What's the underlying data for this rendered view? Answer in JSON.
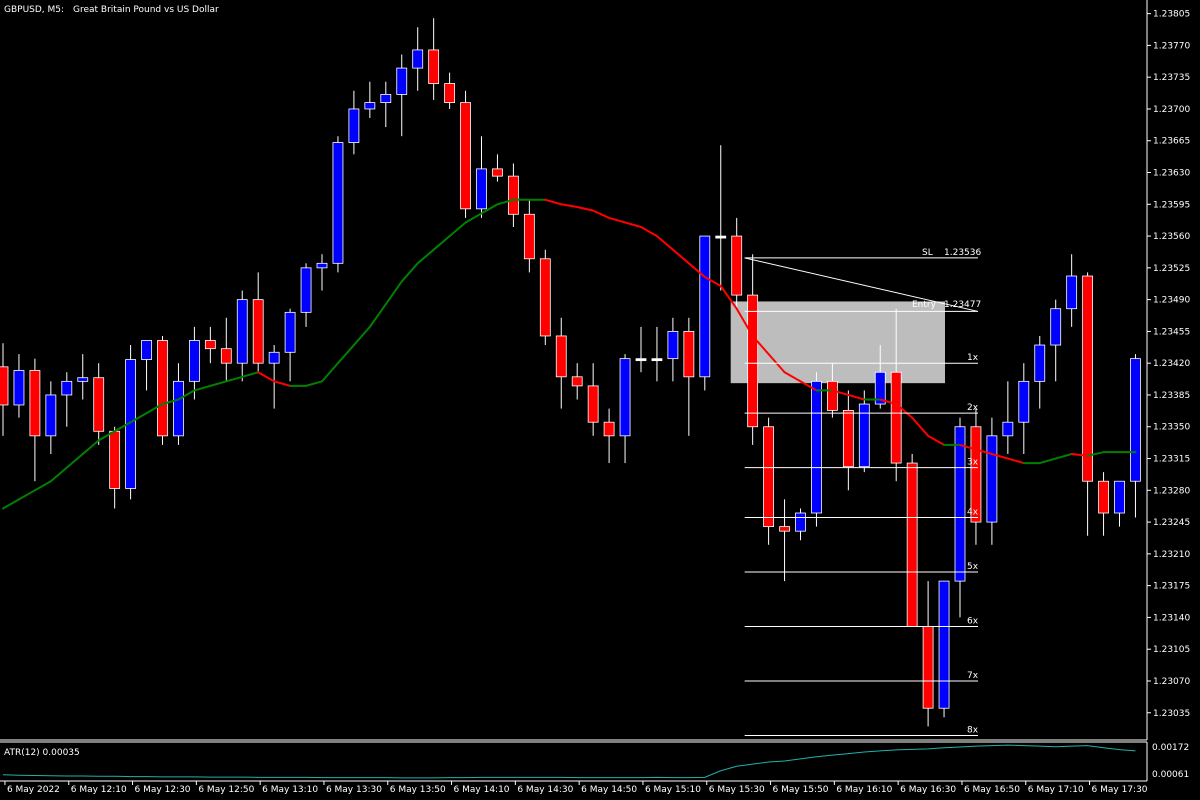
{
  "header": {
    "symbol_timeframe": "GBPUSD, M5:",
    "description": "Great Britain Pound vs US Dollar"
  },
  "indicator": {
    "label": "ATR(12) 0.00035",
    "scale_labels": [
      "0.00172",
      "0.00061"
    ],
    "range": [
      0.0004,
      0.0018
    ],
    "values": [
      0.0006,
      0.00058,
      0.00057,
      0.00056,
      0.00055,
      0.00055,
      0.00054,
      0.00054,
      0.00053,
      0.00053,
      0.00052,
      0.00052,
      0.00052,
      0.00051,
      0.00051,
      0.00051,
      0.0005,
      0.0005,
      0.0005,
      0.0005,
      0.00049,
      0.00049,
      0.00049,
      0.00049,
      0.00049,
      0.00048,
      0.00048,
      0.00048,
      0.00049,
      0.00049,
      0.0005,
      0.0005,
      0.0005,
      0.0005,
      0.0005,
      0.0005,
      0.00049,
      0.00049,
      0.00049,
      0.00049,
      0.00049,
      0.0005,
      0.00049,
      0.00049,
      0.0005,
      0.00075,
      0.00092,
      0.001,
      0.00108,
      0.00112,
      0.0012,
      0.00128,
      0.00134,
      0.0014,
      0.00146,
      0.0015,
      0.00154,
      0.00156,
      0.00158,
      0.00162,
      0.00165,
      0.00168,
      0.0017,
      0.00172,
      0.0017,
      0.00168,
      0.00166,
      0.00168,
      0.0017,
      0.00162,
      0.00155,
      0.0015
    ]
  },
  "colors": {
    "background": "#000000",
    "bull": "#0000ff",
    "bear": "#ff0000",
    "wick": "#ffffff",
    "ma_up": "#008000",
    "ma_down": "#ff0000",
    "atr_line": "#20b2aa",
    "box": "#bdbdbd"
  },
  "trade_overlay": {
    "sl_label": "SL",
    "sl_price": "1.23536",
    "entry_label": "Entry",
    "entry_price": "1.23477",
    "levels": [
      {
        "label": "1x",
        "price": 1.2342
      },
      {
        "label": "2x",
        "price": 1.23365
      },
      {
        "label": "3x",
        "price": 1.23305
      },
      {
        "label": "4x",
        "price": 1.2325
      },
      {
        "label": "5x",
        "price": 1.2319
      },
      {
        "label": "6x",
        "price": 1.2313
      },
      {
        "label": "7x",
        "price": 1.2307
      },
      {
        "label": "8x",
        "price": 1.2301
      }
    ],
    "box_top": 1.23488,
    "box_bottom": 1.23398
  },
  "chart_data": {
    "type": "candlestick",
    "title": "GBPUSD, M5: Great Britain Pound vs US Dollar",
    "ylim": [
      1.23005,
      1.2382
    ],
    "y_ticks": [
      "1.23805",
      "1.23770",
      "1.23735",
      "1.23700",
      "1.23665",
      "1.23630",
      "1.23595",
      "1.23560",
      "1.23525",
      "1.23490",
      "1.23455",
      "1.23420",
      "1.23385",
      "1.23350",
      "1.23315",
      "1.23280",
      "1.23245",
      "1.23210",
      "1.23175",
      "1.23140",
      "1.23105",
      "1.23070",
      "1.23035"
    ],
    "x_ticks": [
      {
        "index": 1,
        "label": "6 May 2022"
      },
      {
        "index": 5,
        "label": "6 May 12:10"
      },
      {
        "index": 9,
        "label": "6 May 12:30"
      },
      {
        "index": 13,
        "label": "6 May 12:50"
      },
      {
        "index": 17,
        "label": "6 May 13:10"
      },
      {
        "index": 21,
        "label": "6 May 13:30"
      },
      {
        "index": 25,
        "label": "6 May 13:50"
      },
      {
        "index": 29,
        "label": "6 May 14:10"
      },
      {
        "index": 33,
        "label": "6 May 14:30"
      },
      {
        "index": 37,
        "label": "6 May 14:50"
      },
      {
        "index": 41,
        "label": "6 May 15:10"
      },
      {
        "index": 45,
        "label": "6 May 15:30"
      },
      {
        "index": 49,
        "label": "6 May 15:50"
      },
      {
        "index": 53,
        "label": "6 May 16:10"
      },
      {
        "index": 57,
        "label": "6 May 16:30"
      },
      {
        "index": 61,
        "label": "6 May 16:50"
      },
      {
        "index": 65,
        "label": "6 May 17:10"
      },
      {
        "index": 69,
        "label": "6 May 17:30"
      }
    ],
    "ohlc": [
      [
        1.23416,
        1.23442,
        1.2334,
        1.23374
      ],
      [
        1.23374,
        1.2343,
        1.2336,
        1.23412
      ],
      [
        1.23412,
        1.23425,
        1.2329,
        1.2334
      ],
      [
        1.2334,
        1.234,
        1.2332,
        1.23385
      ],
      [
        1.23385,
        1.2341,
        1.2335,
        1.234
      ],
      [
        1.234,
        1.2343,
        1.2338,
        1.23404
      ],
      [
        1.23404,
        1.2342,
        1.2333,
        1.23345
      ],
      [
        1.23345,
        1.2335,
        1.2326,
        1.23282
      ],
      [
        1.23282,
        1.2344,
        1.2327,
        1.23424
      ],
      [
        1.23424,
        1.2344,
        1.2339,
        1.23445
      ],
      [
        1.23445,
        1.2345,
        1.2333,
        1.2334
      ],
      [
        1.2334,
        1.2342,
        1.2333,
        1.234
      ],
      [
        1.234,
        1.2346,
        1.2338,
        1.23445
      ],
      [
        1.23445,
        1.2346,
        1.2342,
        1.23436
      ],
      [
        1.23436,
        1.2347,
        1.234,
        1.2342
      ],
      [
        1.2342,
        1.235,
        1.234,
        1.2349
      ],
      [
        1.2349,
        1.2352,
        1.2341,
        1.2342
      ],
      [
        1.2342,
        1.2344,
        1.2337,
        1.23432
      ],
      [
        1.23432,
        1.2348,
        1.234,
        1.23476
      ],
      [
        1.23476,
        1.2353,
        1.2346,
        1.23525
      ],
      [
        1.23525,
        1.2354,
        1.235,
        1.2353
      ],
      [
        1.2353,
        1.2367,
        1.2352,
        1.23663
      ],
      [
        1.23663,
        1.2372,
        1.2365,
        1.237
      ],
      [
        1.237,
        1.2373,
        1.2369,
        1.23707
      ],
      [
        1.23707,
        1.2373,
        1.2368,
        1.23716
      ],
      [
        1.23716,
        1.2376,
        1.2367,
        1.23745
      ],
      [
        1.23745,
        1.2379,
        1.2372,
        1.23765
      ],
      [
        1.23765,
        1.238,
        1.2371,
        1.23728
      ],
      [
        1.23728,
        1.2374,
        1.237,
        1.23707
      ],
      [
        1.23707,
        1.2372,
        1.2358,
        1.2359
      ],
      [
        1.2359,
        1.2367,
        1.2358,
        1.23634
      ],
      [
        1.23634,
        1.2365,
        1.2362,
        1.23626
      ],
      [
        1.23626,
        1.2364,
        1.2357,
        1.23584
      ],
      [
        1.23584,
        1.236,
        1.2352,
        1.23535
      ],
      [
        1.23535,
        1.23545,
        1.2344,
        1.2345
      ],
      [
        1.2345,
        1.2347,
        1.2337,
        1.23405
      ],
      [
        1.23405,
        1.2342,
        1.2338,
        1.23395
      ],
      [
        1.23395,
        1.2342,
        1.2334,
        1.23355
      ],
      [
        1.23355,
        1.2337,
        1.2331,
        1.2334
      ],
      [
        1.2334,
        1.2343,
        1.2331,
        1.23425
      ],
      [
        1.23425,
        1.2346,
        1.2341,
        1.23425
      ],
      [
        1.23425,
        1.2346,
        1.234,
        1.23425
      ],
      [
        1.23425,
        1.2347,
        1.234,
        1.23455
      ],
      [
        1.23455,
        1.2347,
        1.2334,
        1.23405
      ],
      [
        1.23405,
        1.2353,
        1.2339,
        1.2356
      ],
      [
        1.2356,
        1.2366,
        1.235,
        1.2356
      ],
      [
        1.2356,
        1.2358,
        1.2348,
        1.23495
      ],
      [
        1.23495,
        1.2354,
        1.2333,
        1.2335
      ],
      [
        1.2335,
        1.2336,
        1.2322,
        1.2324
      ],
      [
        1.2324,
        1.2327,
        1.2318,
        1.23235
      ],
      [
        1.23235,
        1.2326,
        1.23225,
        1.23255
      ],
      [
        1.23255,
        1.2341,
        1.2324,
        1.234
      ],
      [
        1.234,
        1.2342,
        1.2336,
        1.23368
      ],
      [
        1.23368,
        1.2339,
        1.2328,
        1.23306
      ],
      [
        1.23306,
        1.2339,
        1.233,
        1.23375
      ],
      [
        1.23375,
        1.2344,
        1.2337,
        1.2341
      ],
      [
        1.2341,
        1.2348,
        1.2329,
        1.2331
      ],
      [
        1.2331,
        1.2332,
        1.2313,
        1.2313
      ],
      [
        1.2313,
        1.2318,
        1.2302,
        1.2304
      ],
      [
        1.2304,
        1.2318,
        1.2303,
        1.2318
      ],
      [
        1.2318,
        1.2336,
        1.2314,
        1.2335
      ],
      [
        1.2335,
        1.2337,
        1.2322,
        1.23245
      ],
      [
        1.23245,
        1.2336,
        1.2322,
        1.2334
      ],
      [
        1.2334,
        1.234,
        1.2332,
        1.23355
      ],
      [
        1.23355,
        1.2342,
        1.2332,
        1.234
      ],
      [
        1.234,
        1.2345,
        1.2337,
        1.2344
      ],
      [
        1.2344,
        1.2349,
        1.234,
        1.2348
      ],
      [
        1.2348,
        1.2354,
        1.2346,
        1.23516
      ],
      [
        1.23516,
        1.2352,
        1.2323,
        1.2329
      ],
      [
        1.2329,
        1.233,
        1.2323,
        1.23255
      ],
      [
        1.23255,
        1.2329,
        1.2324,
        1.2329
      ],
      [
        1.2329,
        1.2343,
        1.2325,
        1.23425
      ]
    ],
    "moving_average": [
      1.2326,
      1.2327,
      1.2328,
      1.2329,
      1.23305,
      1.2332,
      1.23335,
      1.23345,
      1.23355,
      1.23365,
      1.23375,
      1.2338,
      1.2339,
      1.23395,
      1.234,
      1.23405,
      1.2341,
      1.234,
      1.23395,
      1.23395,
      1.234,
      1.2342,
      1.2344,
      1.2346,
      1.23485,
      1.2351,
      1.2353,
      1.23545,
      1.2356,
      1.23575,
      1.23585,
      1.23595,
      1.236,
      1.236,
      1.236,
      1.23595,
      1.23592,
      1.23588,
      1.2358,
      1.23575,
      1.2357,
      1.2356,
      1.23545,
      1.2353,
      1.23515,
      1.23505,
      1.2348,
      1.2345,
      1.2343,
      1.2341,
      1.234,
      1.2339,
      1.2339,
      1.23385,
      1.2338,
      1.2338,
      1.23375,
      1.2336,
      1.2334,
      1.2333,
      1.2333,
      1.23325,
      1.2332,
      1.23315,
      1.2331,
      1.2331,
      1.23315,
      1.2332,
      1.23318,
      1.23322,
      1.23322,
      1.23322
    ]
  }
}
